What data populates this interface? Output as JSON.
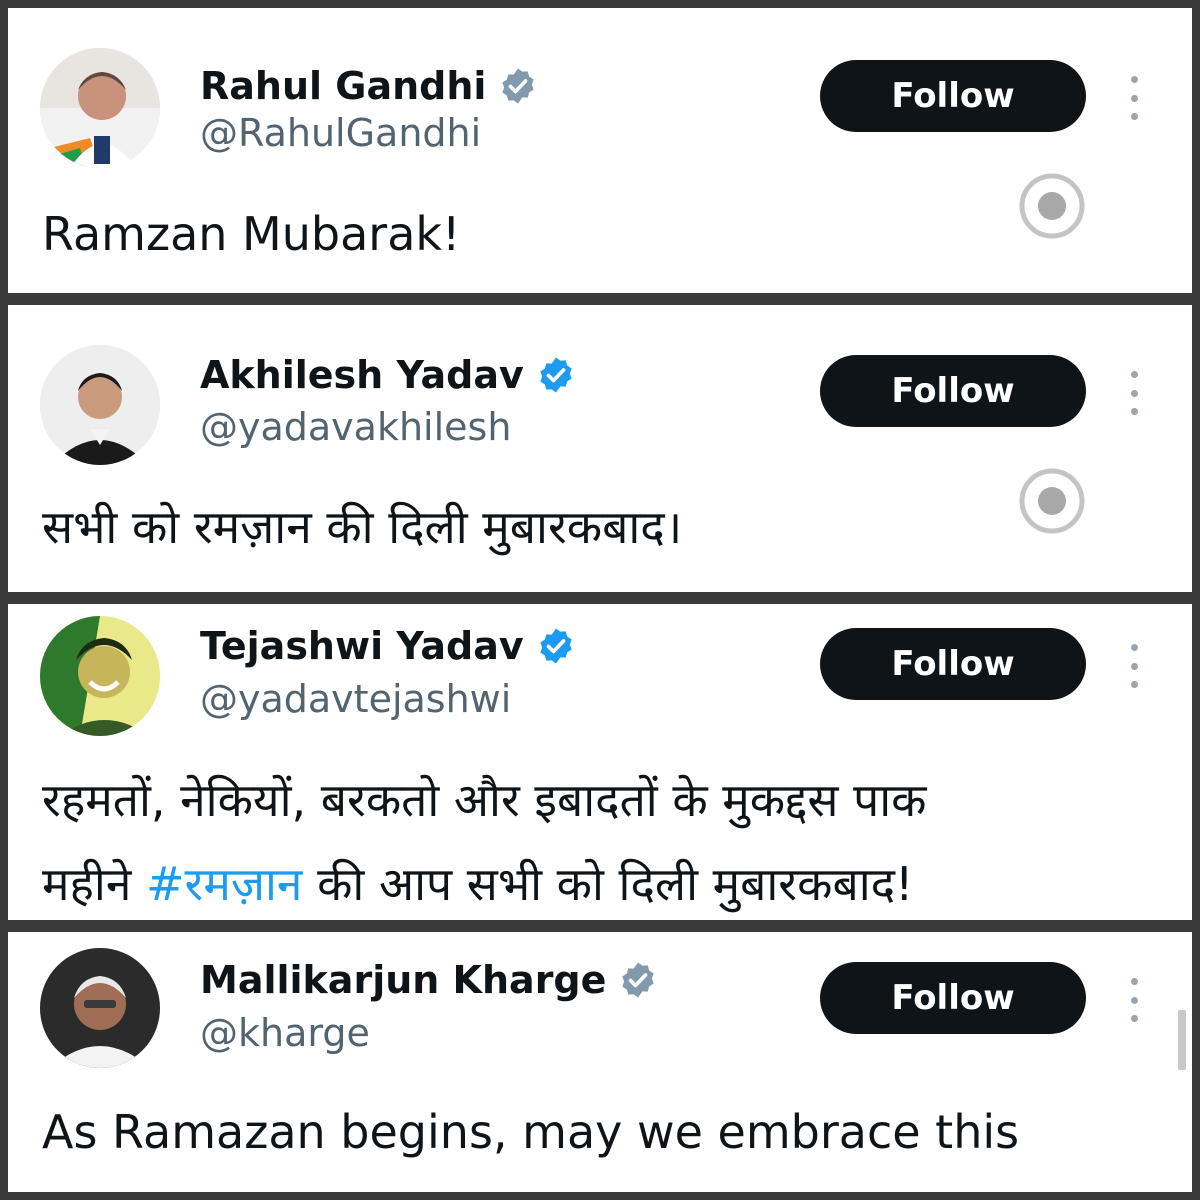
{
  "follow_label": "Follow",
  "colors": {
    "verified_blue": "#1d9bf0",
    "verified_gray": "#829aab",
    "hashtag": "#1d9bf0",
    "follow_bg": "#0f1419"
  },
  "posts": [
    {
      "name": "Rahul Gandhi",
      "handle": "@RahulGandhi",
      "badge": "gray",
      "text": "Ramzan Mubarak!"
    },
    {
      "name": "Akhilesh Yadav",
      "handle": "@yadavakhilesh",
      "badge": "blue",
      "text": "सभी को रमज़ान की दिली मुबारकबाद।"
    },
    {
      "name": "Tejashwi Yadav",
      "handle": "@yadavtejashwi",
      "badge": "blue",
      "text_line1": "रहमतों, नेकियों, बरकतो और इबादतों के मुकद्दस पाक",
      "text_line2_before": "महीने ",
      "hashtag": "#रमज़ान",
      "text_line2_after": " की आप सभी को दिली मुबारकबाद!"
    },
    {
      "name": "Mallikarjun Kharge",
      "handle": "@kharge",
      "badge": "gray",
      "text_line1": "As Ramazan begins, may we embrace this"
    }
  ]
}
